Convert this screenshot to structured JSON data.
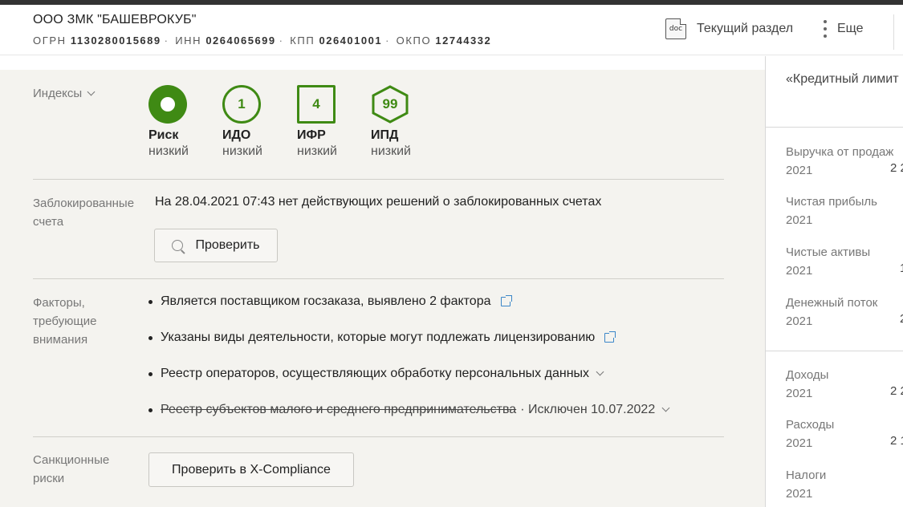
{
  "header": {
    "company_name": "ООО ЗМК \"БАШЕВРОКУБ\"",
    "ogrn_label": "ОГРН",
    "ogrn_value": "1130280015689",
    "inn_label": "ИНН",
    "inn_value": "0264065699",
    "kpp_label": "КПП",
    "kpp_value": "026401001",
    "okpo_label": "ОКПО",
    "okpo_value": "12744332",
    "current_section_label": "Текущий раздел",
    "doc_icon_text": "doc",
    "more_label": "Еще"
  },
  "indices": {
    "label": "Индексы",
    "items": [
      {
        "name": "Риск",
        "level": "низкий",
        "value": ""
      },
      {
        "name": "ИДО",
        "level": "низкий",
        "value": "1"
      },
      {
        "name": "ИФР",
        "level": "низкий",
        "value": "4"
      },
      {
        "name": "ИПД",
        "level": "низкий",
        "value": "99"
      }
    ],
    "accent_color": "#3f8a14"
  },
  "blocked": {
    "label_line1": "Заблокированные",
    "label_line2": "счета",
    "text": "На 28.04.2021 07:43 нет действующих решений о заблокированных счетах",
    "check_button": "Проверить"
  },
  "factors": {
    "label_line1": "Факторы,",
    "label_line2": "требующие",
    "label_line3": "внимания",
    "items": [
      {
        "text": "Является поставщиком госзаказа, выявлено 2 фактора"
      },
      {
        "text": "Указаны виды деятельности, которые могут подлежать лицензированию"
      },
      {
        "text": "Реестр операторов, осуществляющих обработку персональных данных"
      },
      {
        "text": "Реестр субъектов малого и среднего предпринимательства",
        "extra": "· Исключен 10.07.2022"
      }
    ]
  },
  "sanctions": {
    "label_line1": "Санкционные",
    "label_line2": "риски",
    "button": "Проверить в X-Compliance"
  },
  "right_panel": {
    "title": "«Кредитный лимит",
    "items": [
      {
        "label": "Выручка от продаж",
        "year": "2021",
        "value": "2 2"
      },
      {
        "label": "Чистая прибыль",
        "year": "2021",
        "value": ""
      },
      {
        "label": "Чистые активы",
        "year": "2021",
        "value": "1"
      },
      {
        "label": "Денежный поток",
        "year": "2021",
        "value": "2"
      },
      {
        "label": "Доходы",
        "year": "2021",
        "value": "2 2"
      },
      {
        "label": "Расходы",
        "year": "2021",
        "value": "2 1"
      },
      {
        "label": "Налоги",
        "year": "2021",
        "value": ""
      }
    ]
  }
}
